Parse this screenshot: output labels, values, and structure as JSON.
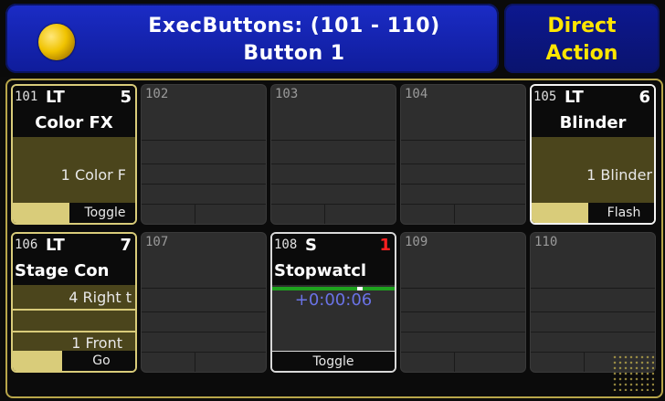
{
  "header": {
    "title_line1": "ExecButtons: (101 - 110)",
    "title_line2": "Button  1",
    "direct_line1": "Direct",
    "direct_line2": "Action"
  },
  "cells": {
    "c101": {
      "num": "101",
      "type": "LT",
      "page": "5",
      "name": "Color FX",
      "text1": "1 Color F",
      "button": "Toggle"
    },
    "c102": {
      "num": "102"
    },
    "c103": {
      "num": "103"
    },
    "c104": {
      "num": "104"
    },
    "c105": {
      "num": "105",
      "type": "LT",
      "page": "6",
      "name": "Blinder",
      "text1": "1 Blinder",
      "button": "Flash"
    },
    "c106": {
      "num": "106",
      "type": "LT",
      "page": "7",
      "name": "Stage Con",
      "text1": "4 Right t",
      "text2": "1 Front",
      "button": "Go"
    },
    "c107": {
      "num": "107"
    },
    "c108": {
      "num": "108",
      "type": "S",
      "page": "1",
      "name": "Stopwatcl",
      "time": "+0:00:06",
      "button": "Toggle"
    },
    "c109": {
      "num": "109"
    },
    "c110": {
      "num": "110"
    }
  },
  "colors": {
    "header_blue": "#1b2cc6",
    "accent_yellow": "#ffe600",
    "frame_gold": "#b8a64a",
    "active_fill": "#4b451c",
    "stopwatch_time": "#6a73e6",
    "progress_green": "#1ea21e",
    "red_page": "#ff2020"
  }
}
